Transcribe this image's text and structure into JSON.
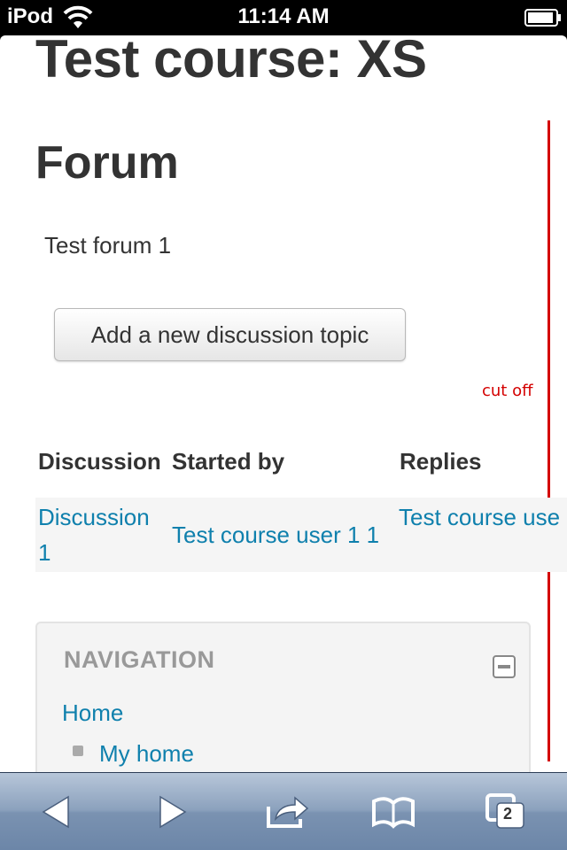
{
  "status_bar": {
    "carrier": "iPod",
    "time": "11:14 AM"
  },
  "page": {
    "course_title": "Test course: XS",
    "forum_title": "Forum",
    "forum_intro": "Test forum 1",
    "add_button_label": "Add a new discussion topic"
  },
  "annotation": {
    "cutoff_label": "cut off",
    "color": "#d40000"
  },
  "table": {
    "headers": [
      "Discussion",
      "Started by",
      "Replies"
    ],
    "rows": [
      {
        "discussion_line1": "Discussion",
        "discussion_line2": "1",
        "started_by": "Test course user 1 1",
        "replies": "Test course use"
      }
    ]
  },
  "navigation": {
    "title": "NAVIGATION",
    "items": [
      {
        "label": "Home"
      },
      {
        "label": "My home"
      }
    ]
  },
  "toolbar": {
    "icons": [
      "back-icon",
      "forward-icon",
      "share-icon",
      "bookmarks-icon",
      "tabs-icon"
    ],
    "tabs_count": "2"
  },
  "colors": {
    "link": "#0f80ad",
    "heading": "#333333",
    "toolbar": "#7a92b1"
  }
}
